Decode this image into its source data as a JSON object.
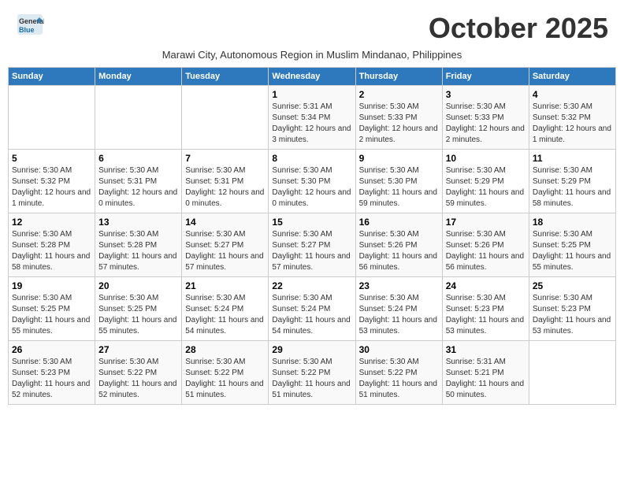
{
  "header": {
    "logo_line1": "General",
    "logo_line2": "Blue",
    "month_title": "October 2025",
    "subtitle": "Marawi City, Autonomous Region in Muslim Mindanao, Philippines"
  },
  "columns": [
    "Sunday",
    "Monday",
    "Tuesday",
    "Wednesday",
    "Thursday",
    "Friday",
    "Saturday"
  ],
  "weeks": [
    {
      "days": [
        {
          "num": "",
          "info": ""
        },
        {
          "num": "",
          "info": ""
        },
        {
          "num": "",
          "info": ""
        },
        {
          "num": "1",
          "info": "Sunrise: 5:31 AM\nSunset: 5:34 PM\nDaylight: 12 hours and 3 minutes."
        },
        {
          "num": "2",
          "info": "Sunrise: 5:30 AM\nSunset: 5:33 PM\nDaylight: 12 hours and 2 minutes."
        },
        {
          "num": "3",
          "info": "Sunrise: 5:30 AM\nSunset: 5:33 PM\nDaylight: 12 hours and 2 minutes."
        },
        {
          "num": "4",
          "info": "Sunrise: 5:30 AM\nSunset: 5:32 PM\nDaylight: 12 hours and 1 minute."
        }
      ]
    },
    {
      "days": [
        {
          "num": "5",
          "info": "Sunrise: 5:30 AM\nSunset: 5:32 PM\nDaylight: 12 hours and 1 minute."
        },
        {
          "num": "6",
          "info": "Sunrise: 5:30 AM\nSunset: 5:31 PM\nDaylight: 12 hours and 0 minutes."
        },
        {
          "num": "7",
          "info": "Sunrise: 5:30 AM\nSunset: 5:31 PM\nDaylight: 12 hours and 0 minutes."
        },
        {
          "num": "8",
          "info": "Sunrise: 5:30 AM\nSunset: 5:30 PM\nDaylight: 12 hours and 0 minutes."
        },
        {
          "num": "9",
          "info": "Sunrise: 5:30 AM\nSunset: 5:30 PM\nDaylight: 11 hours and 59 minutes."
        },
        {
          "num": "10",
          "info": "Sunrise: 5:30 AM\nSunset: 5:29 PM\nDaylight: 11 hours and 59 minutes."
        },
        {
          "num": "11",
          "info": "Sunrise: 5:30 AM\nSunset: 5:29 PM\nDaylight: 11 hours and 58 minutes."
        }
      ]
    },
    {
      "days": [
        {
          "num": "12",
          "info": "Sunrise: 5:30 AM\nSunset: 5:28 PM\nDaylight: 11 hours and 58 minutes."
        },
        {
          "num": "13",
          "info": "Sunrise: 5:30 AM\nSunset: 5:28 PM\nDaylight: 11 hours and 57 minutes."
        },
        {
          "num": "14",
          "info": "Sunrise: 5:30 AM\nSunset: 5:27 PM\nDaylight: 11 hours and 57 minutes."
        },
        {
          "num": "15",
          "info": "Sunrise: 5:30 AM\nSunset: 5:27 PM\nDaylight: 11 hours and 57 minutes."
        },
        {
          "num": "16",
          "info": "Sunrise: 5:30 AM\nSunset: 5:26 PM\nDaylight: 11 hours and 56 minutes."
        },
        {
          "num": "17",
          "info": "Sunrise: 5:30 AM\nSunset: 5:26 PM\nDaylight: 11 hours and 56 minutes."
        },
        {
          "num": "18",
          "info": "Sunrise: 5:30 AM\nSunset: 5:25 PM\nDaylight: 11 hours and 55 minutes."
        }
      ]
    },
    {
      "days": [
        {
          "num": "19",
          "info": "Sunrise: 5:30 AM\nSunset: 5:25 PM\nDaylight: 11 hours and 55 minutes."
        },
        {
          "num": "20",
          "info": "Sunrise: 5:30 AM\nSunset: 5:25 PM\nDaylight: 11 hours and 55 minutes."
        },
        {
          "num": "21",
          "info": "Sunrise: 5:30 AM\nSunset: 5:24 PM\nDaylight: 11 hours and 54 minutes."
        },
        {
          "num": "22",
          "info": "Sunrise: 5:30 AM\nSunset: 5:24 PM\nDaylight: 11 hours and 54 minutes."
        },
        {
          "num": "23",
          "info": "Sunrise: 5:30 AM\nSunset: 5:24 PM\nDaylight: 11 hours and 53 minutes."
        },
        {
          "num": "24",
          "info": "Sunrise: 5:30 AM\nSunset: 5:23 PM\nDaylight: 11 hours and 53 minutes."
        },
        {
          "num": "25",
          "info": "Sunrise: 5:30 AM\nSunset: 5:23 PM\nDaylight: 11 hours and 53 minutes."
        }
      ]
    },
    {
      "days": [
        {
          "num": "26",
          "info": "Sunrise: 5:30 AM\nSunset: 5:23 PM\nDaylight: 11 hours and 52 minutes."
        },
        {
          "num": "27",
          "info": "Sunrise: 5:30 AM\nSunset: 5:22 PM\nDaylight: 11 hours and 52 minutes."
        },
        {
          "num": "28",
          "info": "Sunrise: 5:30 AM\nSunset: 5:22 PM\nDaylight: 11 hours and 51 minutes."
        },
        {
          "num": "29",
          "info": "Sunrise: 5:30 AM\nSunset: 5:22 PM\nDaylight: 11 hours and 51 minutes."
        },
        {
          "num": "30",
          "info": "Sunrise: 5:30 AM\nSunset: 5:22 PM\nDaylight: 11 hours and 51 minutes."
        },
        {
          "num": "31",
          "info": "Sunrise: 5:31 AM\nSunset: 5:21 PM\nDaylight: 11 hours and 50 minutes."
        },
        {
          "num": "",
          "info": ""
        }
      ]
    }
  ]
}
